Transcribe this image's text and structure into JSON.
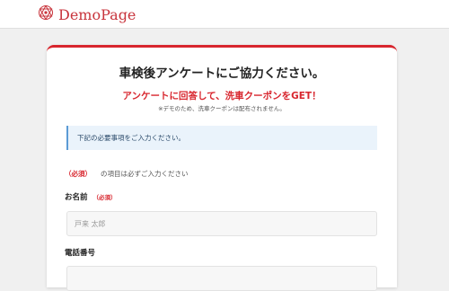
{
  "header": {
    "logo_text": "DemoPage",
    "brand_color": "#c8343c"
  },
  "form": {
    "title": "車検後アンケートにご協力ください。",
    "subtitle": "アンケートに回答して、洗車クーポンをGET！",
    "note": "※デモのため、洗車クーポンは配布されません。",
    "info_text": "下記の必要事項をご入力ください。",
    "required_tag": "（必須）",
    "required_explain": "の項目は必ずご入力ください",
    "fields": [
      {
        "label": "お名前",
        "required_badge": "（必須）",
        "placeholder": "戸来 太郎",
        "value": ""
      },
      {
        "label": "電話番号",
        "placeholder": "",
        "value": ""
      }
    ],
    "accent_color": "#d8262e"
  }
}
